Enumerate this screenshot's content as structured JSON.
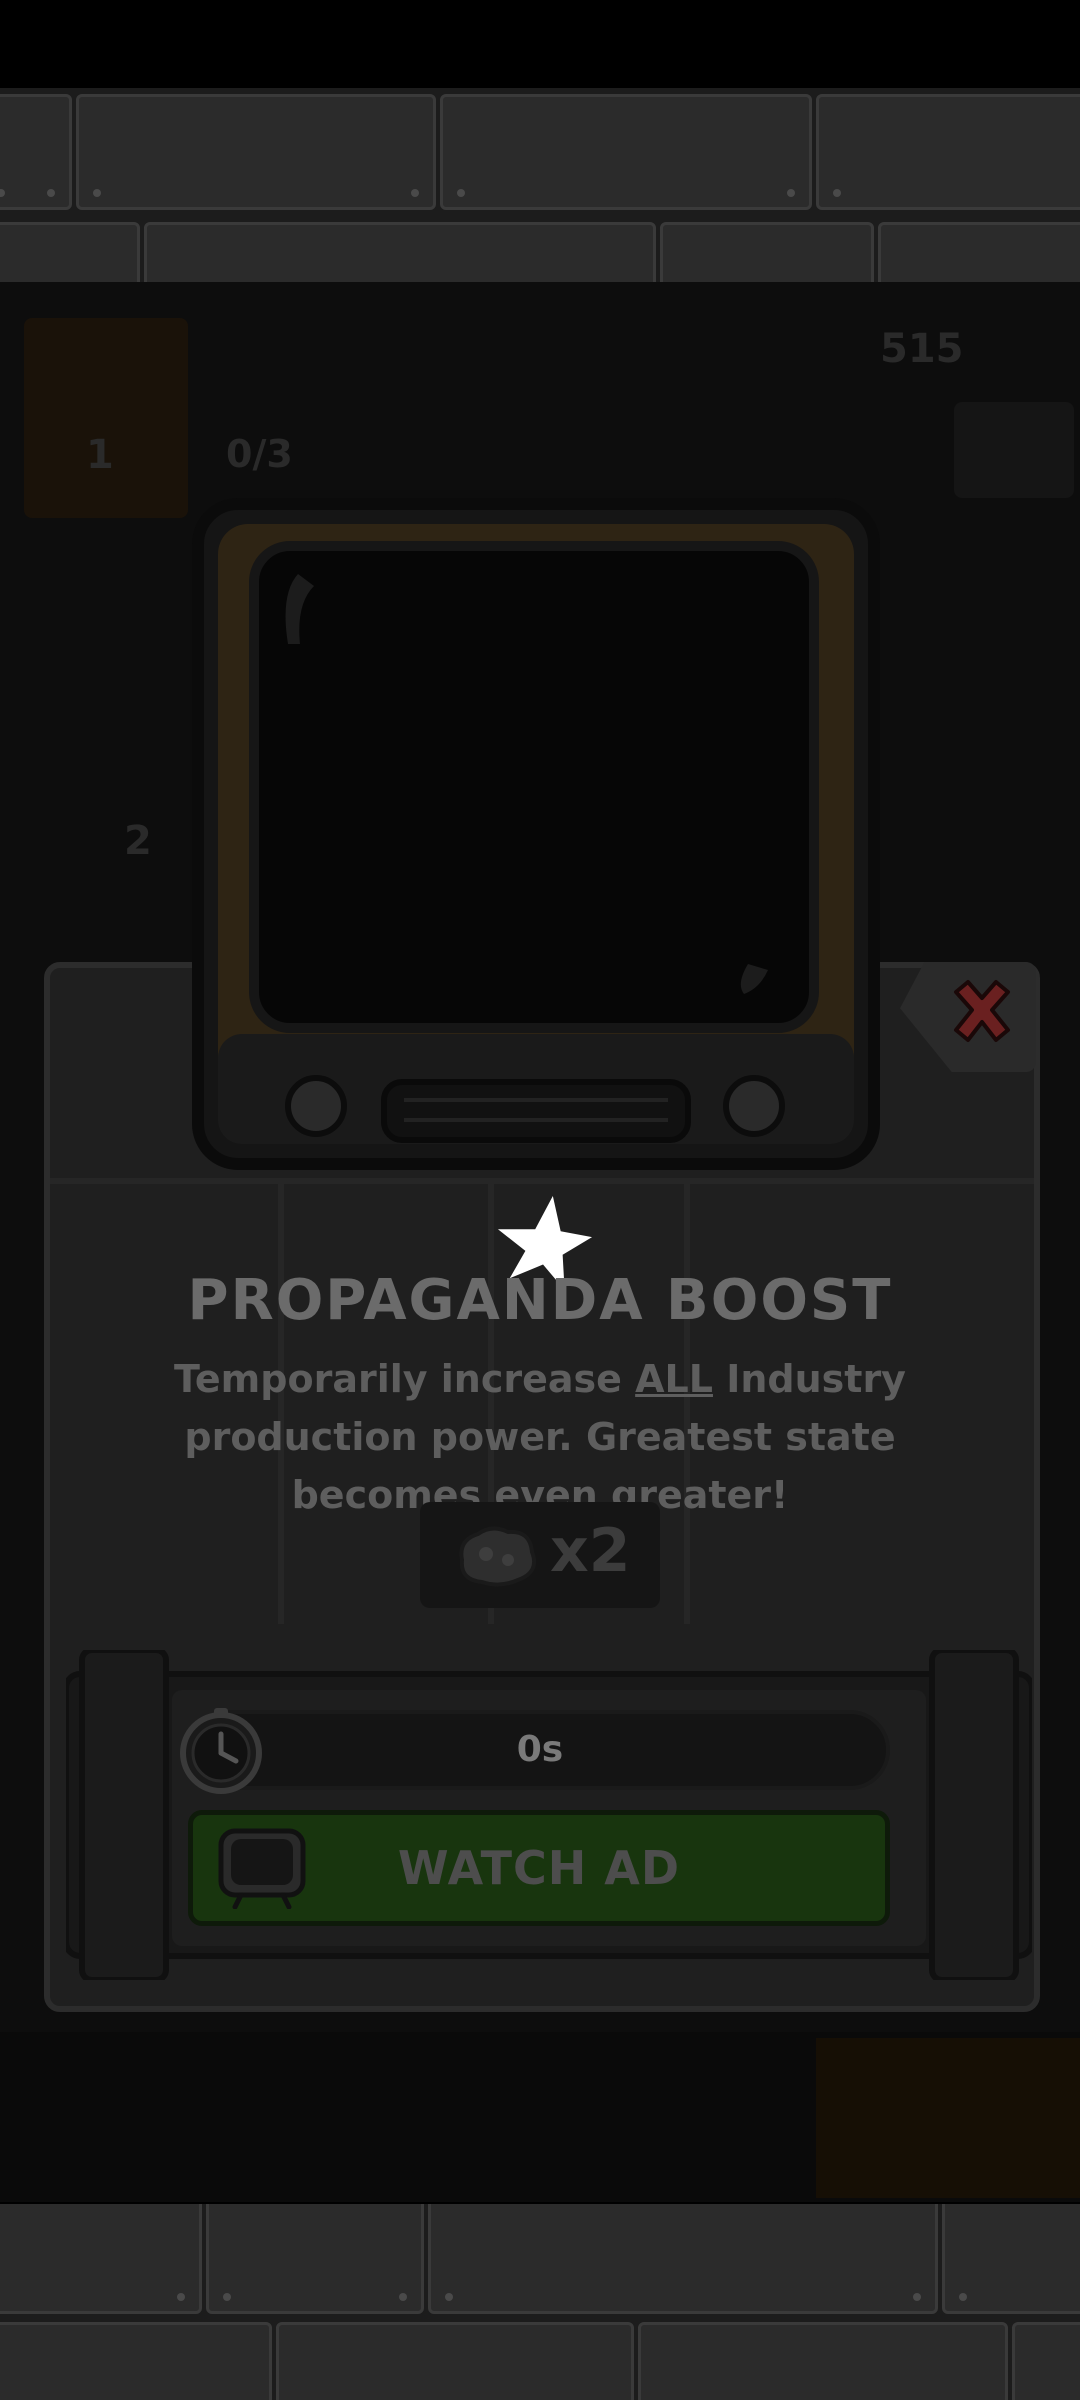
{
  "popup": {
    "title": "PROPAGANDA BOOST",
    "description_before": "Temporarily increase ",
    "description_emphasis": "ALL",
    "description_after": " Industry production power. Greatest state becomes even greater!",
    "multiplier": "x2",
    "timer": "0s",
    "watch_button": "WATCH AD"
  },
  "background_hud": {
    "counter_a": "1",
    "counter_b": "0/3",
    "counter_c": "515",
    "counter_d": "2"
  },
  "colors": {
    "close_x": "#6a2020",
    "watch_button": "#18350e",
    "star": "#ffffff"
  },
  "icons": [
    "close-icon",
    "tv-icon",
    "star-icon",
    "ore-icon",
    "clock-icon"
  ]
}
